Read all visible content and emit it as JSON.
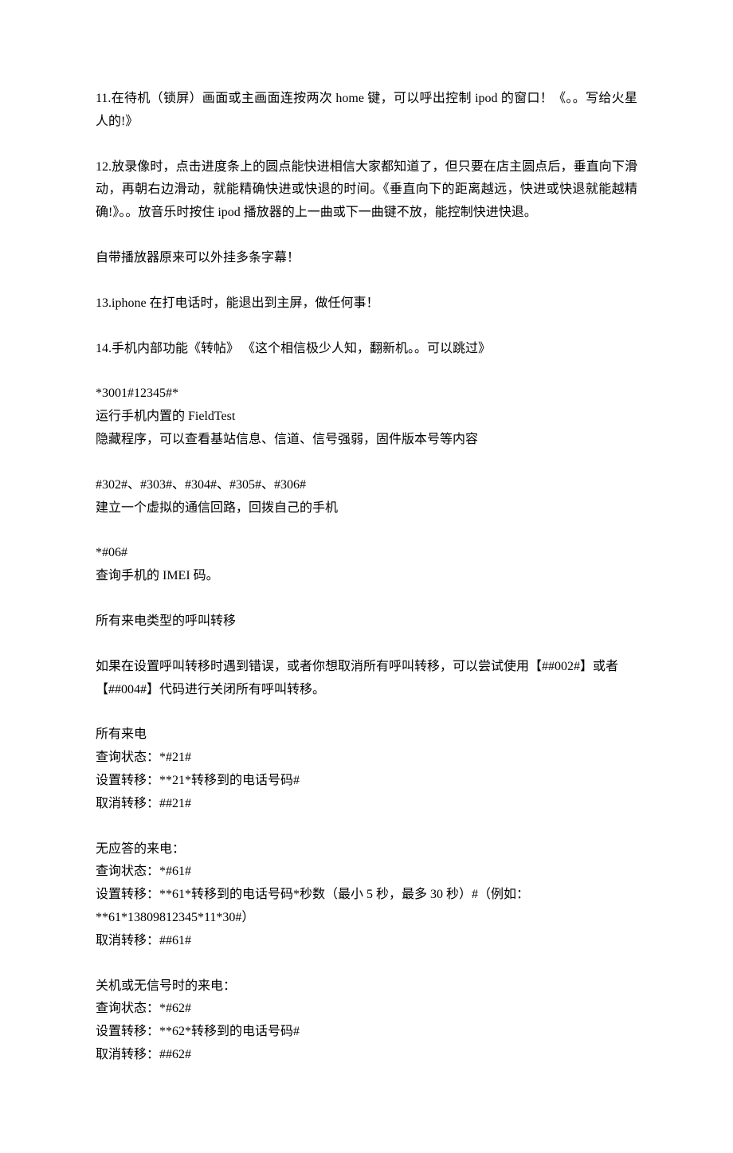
{
  "paragraphs": {
    "p11": "11.在待机（锁屏）画面或主画面连按两次 home 键，可以呼出控制 ipod 的窗口！《。。写给火星人的!》",
    "p12": "12.放录像时，点击进度条上的圆点能快进相信大家都知道了，但只要在店主圆点后，垂直向下滑动，再朝右边滑动，就能精确快进或快退的时间。《垂直向下的距离越远，快进或快退就能越精确!》。。放音乐时按住 ipod 播放器的上一曲或下一曲键不放，能控制快进快退。",
    "p_subtitle": "自带播放器原来可以外挂多条字幕！",
    "p13": "13.iphone 在打电话时，能退出到主屏，做任何事！",
    "p14": "14.手机内部功能《转帖》  《这个相信极少人知，翻新机。。可以跳过》"
  },
  "blocks": {
    "fieldtest": {
      "l1": "*3001#12345#*",
      "l2": "运行手机内置的  FieldTest",
      "l3": "隐藏程序，可以查看基站信息、信道、信号强弱，固件版本号等内容"
    },
    "loopback": {
      "l1": "#302#、#303#、#304#、#305#、#306#",
      "l2": "建立一个虚拟的通信回路，回拨自己的手机"
    },
    "imei": {
      "l1": "*#06#",
      "l2": "查询手机的 IMEI  码。"
    },
    "forward_all_title": "所有来电类型的呼叫转移",
    "forward_note": "如果在设置呼叫转移时遇到错误，或者你想取消所有呼叫转移，可以尝试使用【##002#】或者【##004#】代码进行关闭所有呼叫转移。",
    "all_calls": {
      "l1": "所有来电",
      "l2": "查询状态：*#21#",
      "l3": "设置转移：**21*转移到的电话号码#",
      "l4": "取消转移：##21#"
    },
    "no_answer": {
      "l1": "无应答的来电：",
      "l2": "查询状态：*#61#",
      "l3": "设置转移：**61*转移到的电话号码*秒数（最小 5 秒，最多 30 秒）#（例如：**61*13809812345*11*30#）",
      "l4": "取消转移：##61#"
    },
    "off_nosignal": {
      "l1": "关机或无信号时的来电：",
      "l2": "查询状态：*#62#",
      "l3": "设置转移：**62*转移到的电话号码#",
      "l4": "取消转移：##62#"
    }
  }
}
